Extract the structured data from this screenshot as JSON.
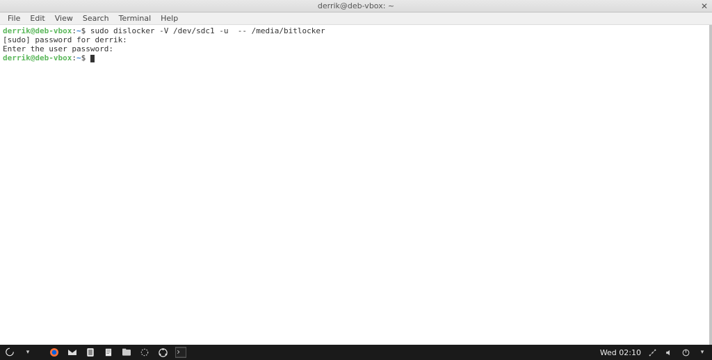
{
  "window": {
    "title": "derrik@deb-vbox: ~"
  },
  "menu": {
    "file": "File",
    "edit": "Edit",
    "view": "View",
    "search": "Search",
    "terminal": "Terminal",
    "help": "Help"
  },
  "terminal": {
    "line1_user": "derrik@deb-vbox",
    "line1_sep": ":",
    "line1_path": "~",
    "line1_dollar": "$ ",
    "line1_cmd": "sudo dislocker -V /dev/sdc1 -u  -- /media/bitlocker",
    "line2": "[sudo] password for derrik:",
    "line3": "Enter the user password:",
    "line4_user": "derrik@deb-vbox",
    "line4_sep": ":",
    "line4_path": "~",
    "line4_dollar": "$ "
  },
  "taskbar": {
    "clock": "Wed 02:10"
  }
}
